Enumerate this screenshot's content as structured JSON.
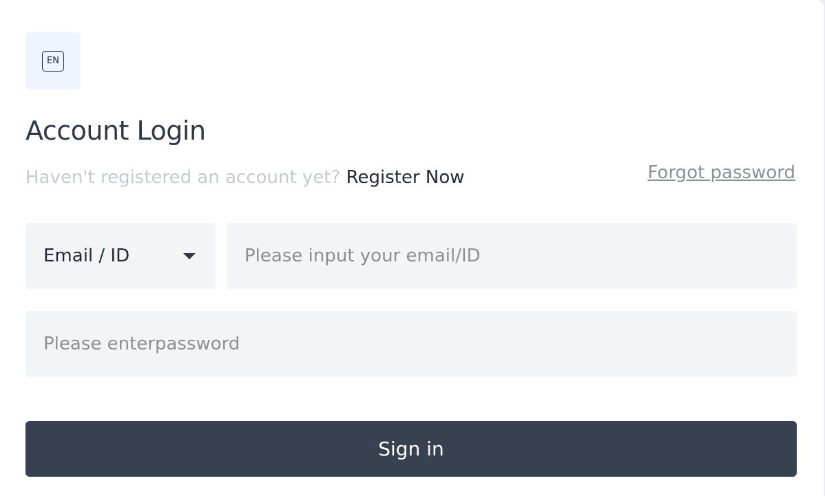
{
  "language": {
    "code": "EN",
    "icon": "language-icon"
  },
  "login": {
    "title": "Account Login",
    "no_account_text": "Haven't registered an account yet?",
    "register_link": "Register Now",
    "forgot_password": "Forgot password",
    "account_type": {
      "selected": "Email / ID",
      "icon": "caret-down-icon"
    },
    "email_placeholder": "Please input your email/ID",
    "email_value": "",
    "password_placeholder": "Please enterpassword",
    "password_value": "",
    "signin_label": "Sign in"
  },
  "colors": {
    "primary_button": "#374151",
    "input_background": "#f3f4f6",
    "language_background": "#eef5ff",
    "muted_text": "#c6cad0",
    "link_text": "#8b8f96",
    "title_text": "#2f3847"
  }
}
